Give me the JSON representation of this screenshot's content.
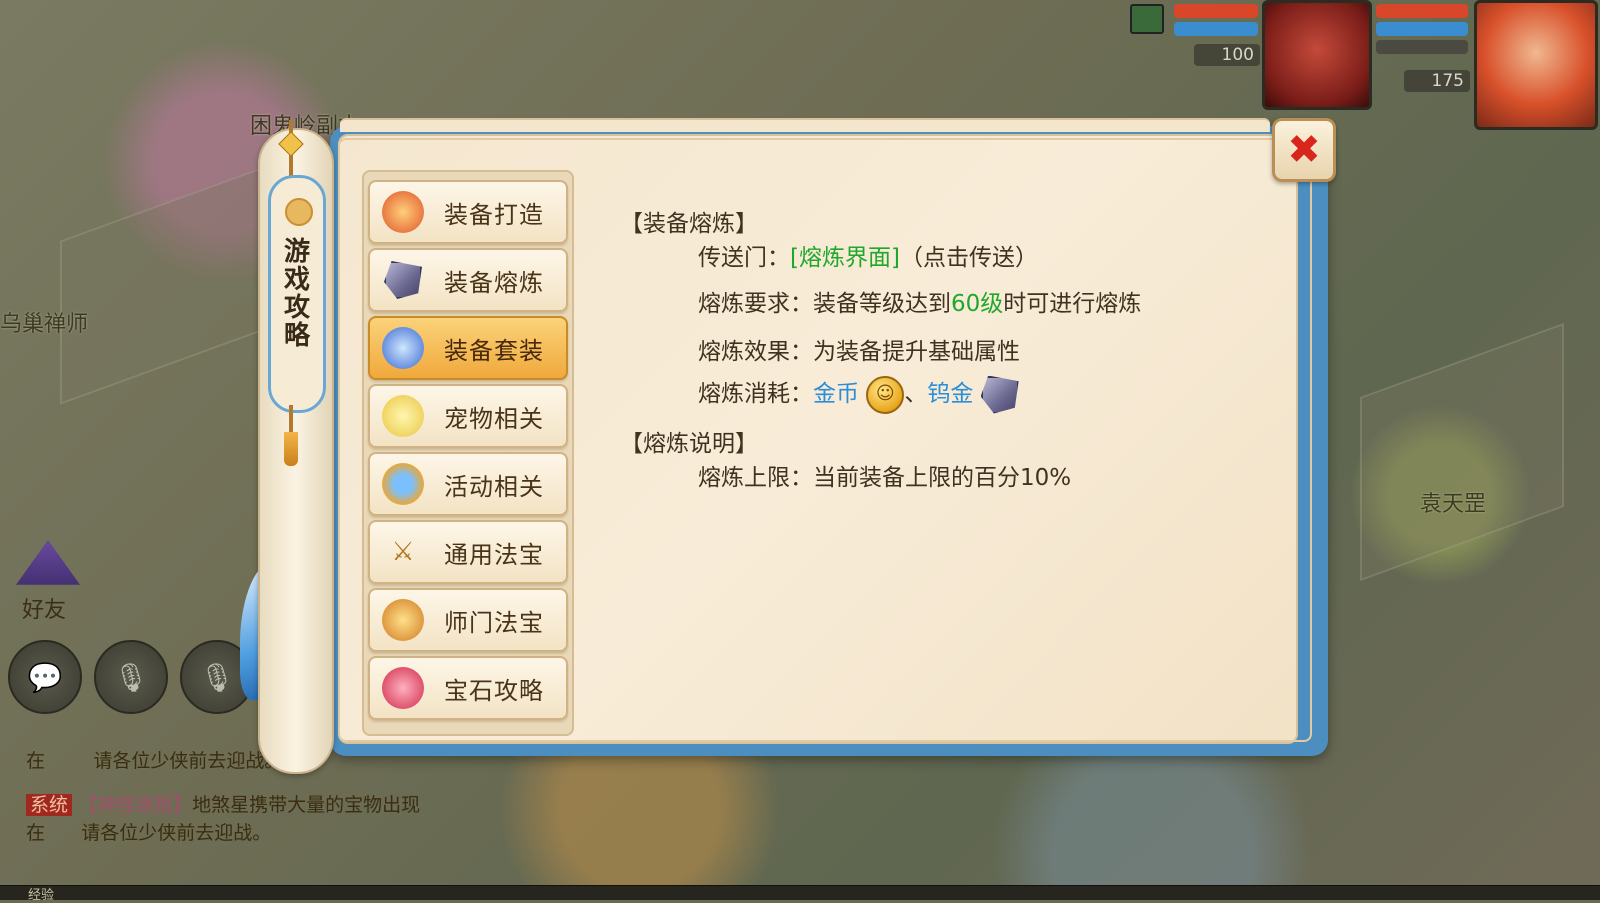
{
  "scene": {
    "npc_left_top": "困鬼岭副本",
    "npc_left_mid": "乌巢禅师",
    "npc_right": "袁天罡",
    "friend_label": "好友"
  },
  "hud": {
    "pet_level": "100",
    "player_level": "175",
    "colors": {
      "hp": "#d8472a",
      "mp": "#3a8ed0"
    }
  },
  "chat": {
    "line1_prefix": "在",
    "line1_suffix": "请各位少侠前去迎战。",
    "line2_tag": "系统",
    "line2_link": "【神怪速报】",
    "line2_text": "地煞星携带大量的宝物出现",
    "line3_prefix": "在",
    "line3_suffix": "请各位少侠前去迎战。",
    "exp_label": "经验"
  },
  "dialog": {
    "side_tab_label": "游戏攻略",
    "close_icon": "close-x-icon",
    "nav": [
      {
        "label": "装备打造",
        "icon": "forge-icon",
        "active": false
      },
      {
        "label": "装备熔炼",
        "icon": "smelt-ore-icon",
        "active": false
      },
      {
        "label": "装备套装",
        "icon": "armor-set-icon",
        "active": true
      },
      {
        "label": "宠物相关",
        "icon": "pet-icon",
        "active": false
      },
      {
        "label": "活动相关",
        "icon": "activity-icon",
        "active": false
      },
      {
        "label": "通用法宝",
        "icon": "crossed-swords-icon",
        "active": false
      },
      {
        "label": "师门法宝",
        "icon": "bell-icon",
        "active": false
      },
      {
        "label": "宝石攻略",
        "icon": "gem-icon",
        "active": false
      }
    ],
    "content": {
      "section1_title": "【装备熔炼】",
      "portal_label": "传送门：",
      "portal_link": "[熔炼界面]",
      "portal_hint": "（点击传送）",
      "req_label": "熔炼要求：",
      "req_text_before": "装备等级达到",
      "req_level": "60级",
      "req_text_after": "时可进行熔炼",
      "effect_label": "熔炼效果：",
      "effect_text": "为装备提升基础属性",
      "cost_label": "熔炼消耗：",
      "cost_item1": "金币",
      "cost_sep": "、",
      "cost_item2": "钨金",
      "section2_title": "【熔炼说明】",
      "limit_label": "熔炼上限：",
      "limit_text": "当前装备上限的百分10%"
    },
    "colors": {
      "frame_blue": "#4c8ec0",
      "paper": "#f5e7cf",
      "active_tab": "#f0a93c",
      "link_green": "#21a72b",
      "item_blue": "#2b8ed6",
      "close_red": "#d8261c"
    }
  }
}
